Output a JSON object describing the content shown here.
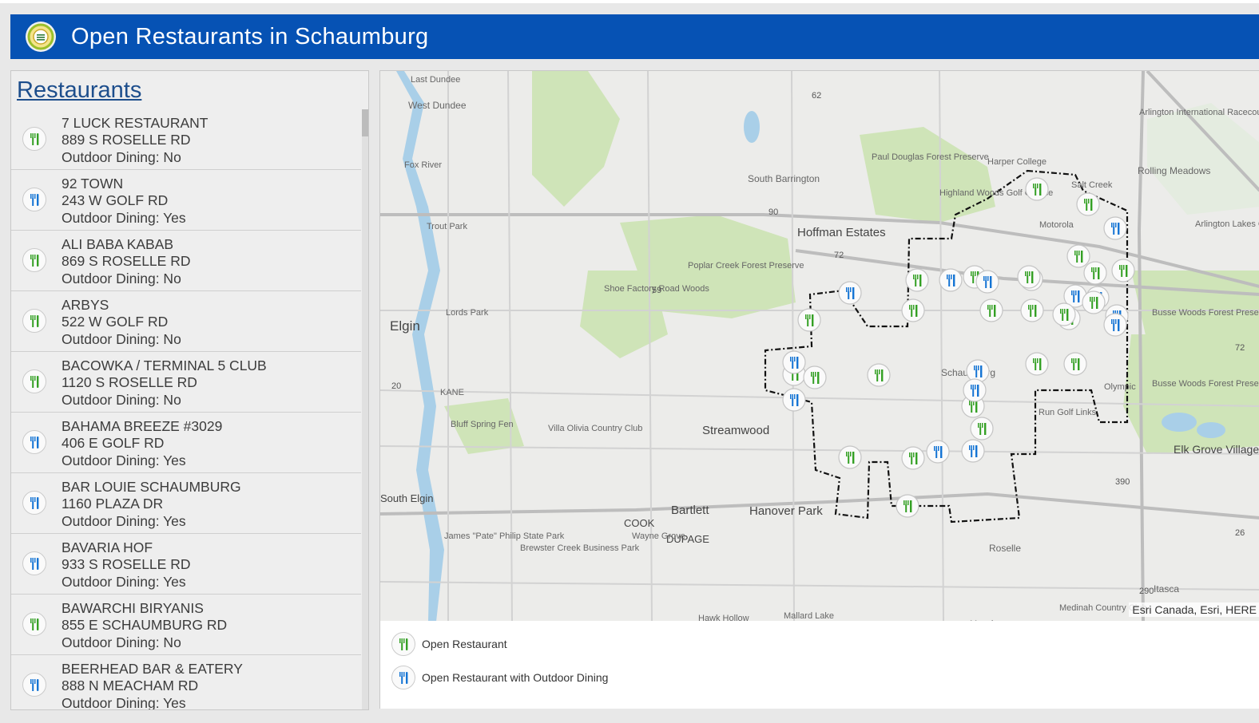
{
  "app": {
    "title": "Open Restaurants in Schaumburg"
  },
  "colors": {
    "header_bg": "#0652b4",
    "open_icon": "#34a024",
    "outdoor_icon": "#1474d4"
  },
  "panel": {
    "title": "Restaurants",
    "items": [
      {
        "name": "7 LUCK RESTAURANT",
        "address": "889 S ROSELLE RD",
        "outdoor": "Outdoor Dining: No",
        "icon": "fork-knife-icon-green"
      },
      {
        "name": "92 TOWN",
        "address": "243 W GOLF RD",
        "outdoor": "Outdoor Dining: Yes",
        "icon": "fork-knife-icon-blue"
      },
      {
        "name": "ALI BABA KABAB",
        "address": "869 S ROSELLE RD",
        "outdoor": "Outdoor Dining: No",
        "icon": "fork-knife-icon-green"
      },
      {
        "name": "ARBYS",
        "address": "522 W GOLF RD",
        "outdoor": "Outdoor Dining: No",
        "icon": "fork-knife-icon-green"
      },
      {
        "name": "BACOWKA / TERMINAL 5 CLUB",
        "address": "1120 S ROSELLE RD",
        "outdoor": "Outdoor Dining: No",
        "icon": "fork-knife-icon-green"
      },
      {
        "name": "BAHAMA BREEZE #3029",
        "address": "406 E GOLF RD",
        "outdoor": "Outdoor Dining: Yes",
        "icon": "fork-knife-icon-blue"
      },
      {
        "name": "BAR LOUIE SCHAUMBURG",
        "address": "1160 PLAZA DR",
        "outdoor": "Outdoor Dining: Yes",
        "icon": "fork-knife-icon-blue"
      },
      {
        "name": "BAVARIA HOF",
        "address": "933 S ROSELLE RD",
        "outdoor": "Outdoor Dining: Yes",
        "icon": "fork-knife-icon-blue"
      },
      {
        "name": "BAWARCHI BIRYANIS",
        "address": "855 E SCHAUMBURG RD",
        "outdoor": "Outdoor Dining: No",
        "icon": "fork-knife-icon-green"
      },
      {
        "name": "BEERHEAD BAR & EATERY",
        "address": "888 N MEACHAM RD",
        "outdoor": "Outdoor Dining: Yes",
        "icon": "fork-knife-icon-blue"
      }
    ]
  },
  "map": {
    "places": [
      "Last Dundee",
      "West Dundee",
      "Elgin",
      "Lords Park",
      "Trout Park",
      "Fox River",
      "South Barrington",
      "Hoffman Estates",
      "Poplar Creek Forest Preserve",
      "Shoe Factory Road Woods",
      "Paul Douglas Forest Preserve",
      "Harper College",
      "Highland Woods Golf Course",
      "Salt Creek",
      "Motorola",
      "Arlington International Racecourse",
      "Rolling Meadows",
      "Arlington Lakes Golf Club",
      "Busse Woods Forest Preserve",
      "Busse Woods Forest Preserve",
      "Schaumburg",
      "Olympic",
      "Run Golf Links",
      "Elk Grove Village",
      "Streamwood",
      "Bluff Spring Fen",
      "Villa Olivia Country Club",
      "KANE",
      "South Elgin",
      "Bartlett",
      "Hanover Park",
      "COOK",
      "DUPAGE",
      "Wayne Grove",
      "James \"Pate\" Philip State Park",
      "Brewster Creek Business Park",
      "Roselle",
      "Itasca",
      "Medinah Country Club",
      "Meacham",
      "Hawk Hollow",
      "Mallard Lake"
    ],
    "highways": [
      "62",
      "90",
      "72",
      "59",
      "20",
      "390",
      "26",
      "290",
      "72"
    ],
    "attribution": "Esri Canada, Esri, HERE"
  },
  "legend": {
    "items": [
      {
        "label": "Open Restaurant",
        "icon": "fork-knife-icon-green"
      },
      {
        "label": "Open Restaurant with Outdoor Dining",
        "icon": "fork-knife-icon-blue"
      }
    ]
  }
}
